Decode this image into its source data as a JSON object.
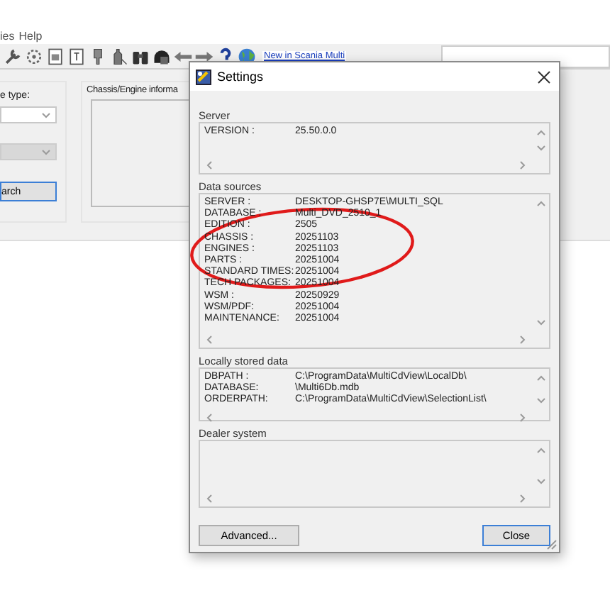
{
  "app": {
    "menu": [
      "ies",
      "Help"
    ],
    "toolbar_link": "New in Scania Multi",
    "left_panel": {
      "label": "e type:",
      "dropdowns": [
        {
          "disabled": false
        },
        {
          "disabled": true
        }
      ],
      "button": "arch"
    },
    "group_title": "Chassis/Engine informa"
  },
  "dialog": {
    "title": "Settings",
    "sections": [
      {
        "title": "Server",
        "rows": [
          {
            "label": "VERSION :",
            "value": "25.50.0.0"
          }
        ]
      },
      {
        "title": "Data sources",
        "rows": [
          {
            "label": "SERVER   :",
            "value": "DESKTOP-GHSP7E\\MULTI_SQL"
          },
          {
            "label": "DATABASE :",
            "value": "Multi_DVD_2510_1"
          },
          {
            "label": "EDITION :",
            "value": "2505"
          },
          {
            "label": "CHASSIS :",
            "value": "20251103"
          },
          {
            "label": "ENGINES :",
            "value": "20251103"
          },
          {
            "label": "PARTS    :",
            "value": "20251004"
          },
          {
            "label": "STANDARD TIMES:",
            "value": "20251004"
          },
          {
            "label": "TECH PACKAGES:",
            "value": "20251004"
          },
          {
            "label": "WSM      :",
            "value": "20250929"
          },
          {
            "label": "WSM/PDF:",
            "value": "20251004"
          },
          {
            "label": "MAINTENANCE:",
            "value": "20251004"
          }
        ]
      },
      {
        "title": "Locally stored data",
        "rows": [
          {
            "label": "DBPATH   :",
            "value": "C:\\ProgramData\\MultiCdView\\LocalDb\\"
          },
          {
            "label": "DATABASE:",
            "value": "\\Multi6Db.mdb"
          },
          {
            "label": "ORDERPATH:",
            "value": "C:\\ProgramData\\MultiCdView\\SelectionList\\"
          }
        ]
      },
      {
        "title": "Dealer system"
      }
    ],
    "buttons": [
      {
        "label": "Advanced...",
        "kind": "secondary"
      },
      {
        "label": "Close",
        "kind": "default"
      }
    ]
  }
}
